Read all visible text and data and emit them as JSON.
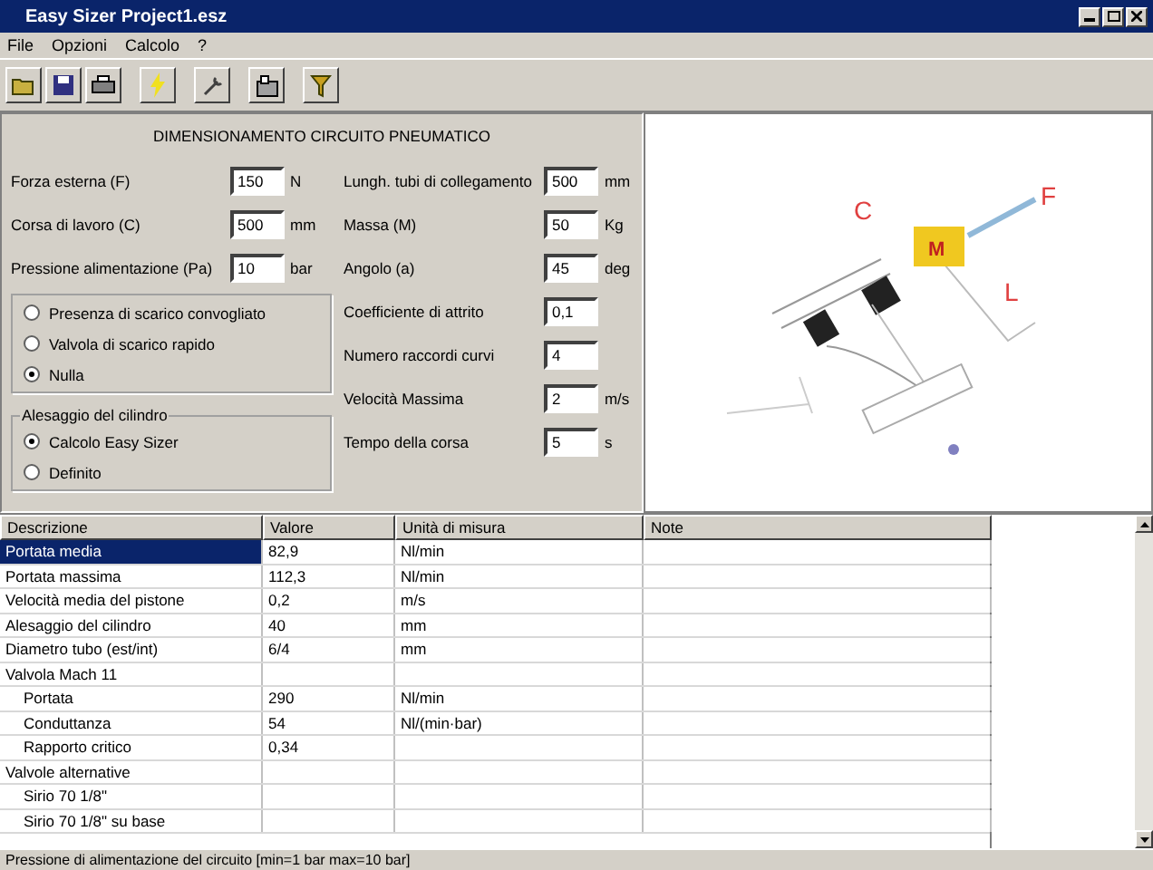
{
  "window": {
    "title": "Easy Sizer Project1.esz"
  },
  "menu": [
    "File",
    "Opzioni",
    "Calcolo",
    "?"
  ],
  "toolbar": [
    {
      "kind": "folder"
    },
    {
      "kind": "save"
    },
    {
      "kind": "print"
    },
    {
      "kind": "bolt"
    },
    {
      "kind": "wrench"
    },
    {
      "kind": "calc"
    },
    {
      "kind": "filter"
    }
  ],
  "form": {
    "heading": "DIMENSIONAMENTO CIRCUITO PNEUMATICO",
    "left_fields": [
      {
        "label": "Forza esterna (F)",
        "value": "150",
        "unit": "N"
      },
      {
        "label": "Corsa di lavoro (C)",
        "value": "500",
        "unit": "mm"
      },
      {
        "label": "Pressione alimentazione (Pa)",
        "value": "10",
        "unit": "bar"
      }
    ],
    "exhaust_options": [
      {
        "label": "Presenza di scarico convogliato",
        "selected": false
      },
      {
        "label": "Valvola di scarico rapido",
        "selected": false
      },
      {
        "label": "Nulla",
        "selected": true
      }
    ],
    "bore_group": {
      "title": "Alesaggio del cilindro",
      "options": [
        {
          "label": "Calcolo Easy Sizer",
          "selected": true
        },
        {
          "label": "Definito",
          "selected": false
        }
      ]
    },
    "right_fields": [
      {
        "label": "Lungh. tubi di collegamento",
        "value": "500",
        "unit": "mm"
      },
      {
        "label": "Massa (M)",
        "value": "50",
        "unit": "Kg"
      },
      {
        "label": "Angolo (a)",
        "value": "45",
        "unit": "deg"
      },
      {
        "label": "Coefficiente di attrito",
        "value": "0,1"
      },
      {
        "label": "Numero raccordi curvi",
        "value": "4"
      },
      {
        "label": "Velocità Massima",
        "value": "2",
        "unit": "m/s"
      },
      {
        "label": "Tempo della corsa",
        "value": "5",
        "unit": "s"
      }
    ]
  },
  "diagram": {
    "labels": [
      "C",
      "F",
      "M",
      "L"
    ]
  },
  "table": {
    "columns": [
      "Descrizione",
      "Valore",
      "Unità di misura",
      "Note"
    ],
    "rows": [
      {
        "cells": [
          "Portata media",
          "82,9",
          "Nl/min",
          ""
        ],
        "selected": true
      },
      {
        "cells": [
          "Portata massima",
          "112,3",
          "Nl/min",
          ""
        ],
        "selected": false
      },
      {
        "cells": [
          "Velocità media del pistone",
          "0,2",
          "m/s",
          ""
        ],
        "selected": false
      },
      {
        "cells": [
          "Alesaggio del cilindro",
          "40",
          "mm",
          ""
        ],
        "selected": false
      },
      {
        "cells": [
          "Diametro tubo (est/int)",
          "6/4",
          "mm",
          ""
        ],
        "selected": false
      },
      {
        "cells": [
          "Valvola Mach 11",
          "",
          "",
          ""
        ],
        "selected": false,
        "children": [
          {
            "cells": [
              "Portata",
              "290",
              "Nl/min",
              ""
            ],
            "selected": false
          },
          {
            "cells": [
              "Conduttanza",
              "54",
              "Nl/(min·bar)",
              ""
            ],
            "selected": false
          },
          {
            "cells": [
              "Rapporto critico",
              "0,34",
              "",
              ""
            ],
            "selected": false
          }
        ]
      },
      {
        "cells": [
          "Valvole alternative",
          "",
          "",
          ""
        ],
        "selected": false,
        "children": [
          {
            "cells": [
              "Sirio 70 1/8\"",
              "",
              "",
              ""
            ],
            "selected": false
          },
          {
            "cells": [
              "Sirio 70 1/8\" su base",
              "",
              "",
              ""
            ],
            "selected": false
          }
        ]
      }
    ]
  },
  "status_bar": "Pressione di alimentazione del circuito [min=1 bar max=10 bar]"
}
